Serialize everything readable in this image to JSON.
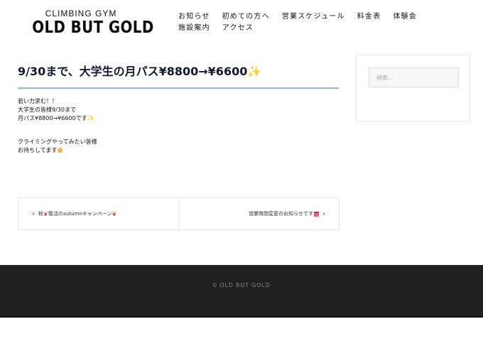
{
  "header": {
    "logo_sub": "CLIMBING GYM",
    "logo_main": "OLD BUT GOLD",
    "nav": [
      "お知らせ",
      "初めての方へ",
      "営業スケジュール",
      "料金表",
      "体験会",
      "施設案内",
      "アクセス"
    ]
  },
  "post": {
    "title": "9/30まで、大学生の月パス¥8800→¥6600",
    "lines_1": [
      "若い力求む！！",
      "大学生の皆様9/30まで",
      "月パス¥8800→¥6600です"
    ],
    "lines_2": [
      "クライミングやってみたい皆様",
      "お待ちしてます"
    ]
  },
  "post_nav": {
    "prev_label": "秋",
    "prev_label_rest": "復活のautumnキャンペーン",
    "next_label": "営業時間変更のお知らせです"
  },
  "sidebar": {
    "search_placeholder": "検索…"
  },
  "footer": {
    "copyright": "© OLD BUT GOLD"
  },
  "colors": {
    "title_rule": "#7ec8c9",
    "footer_bg": "#202020"
  },
  "icons": {
    "title_emoji": "sparkles-icon",
    "body_emoji_1": "sparkles-icon",
    "body_emoji_2": "smiling-face-icon",
    "prev_emoji": "maple-leaf-icon",
    "next_emoji": "calendar-icon",
    "prev_arrow": "chevron-left-icon",
    "next_arrow": "chevron-right-icon"
  }
}
